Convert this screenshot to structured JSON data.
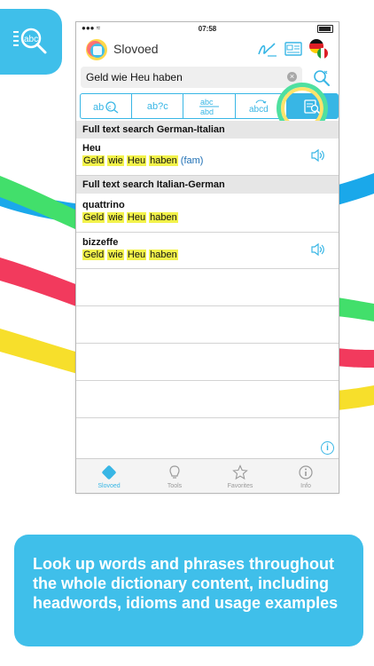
{
  "status": {
    "time": "07:58"
  },
  "app": {
    "title": "Slovoed"
  },
  "search": {
    "query": "Geld wie Heu haben"
  },
  "modes": [
    {
      "label": "abc"
    },
    {
      "label": "ab?c"
    },
    {
      "label": "abc/abd"
    },
    {
      "label": "abcd"
    },
    {
      "label": "full-text"
    }
  ],
  "results": {
    "section1": "Full text search German-Italian",
    "section2": "Full text search Italian-German",
    "entries": [
      {
        "head": "Heu",
        "w1": "Geld",
        "w2": "wie",
        "w3": "Heu",
        "w4": "haben",
        "note": "(fam)"
      },
      {
        "head": "quattrino",
        "w1": "Geld",
        "w2": "wie",
        "w3": "Heu",
        "w4": "haben"
      },
      {
        "head": "bizzeffe",
        "w1": "Geld",
        "w2": "wie",
        "w3": "Heu",
        "w4": "haben"
      }
    ]
  },
  "tabs": [
    {
      "label": "Slovoed"
    },
    {
      "label": "Tools"
    },
    {
      "label": "Favorites"
    },
    {
      "label": "Info"
    }
  ],
  "caption": "Look up words and phrases throughout the whole dictionary content, including headwords, idioms and usage examples",
  "colors": {
    "accent": "#38b6e5",
    "highlight": "#f2f24a"
  }
}
